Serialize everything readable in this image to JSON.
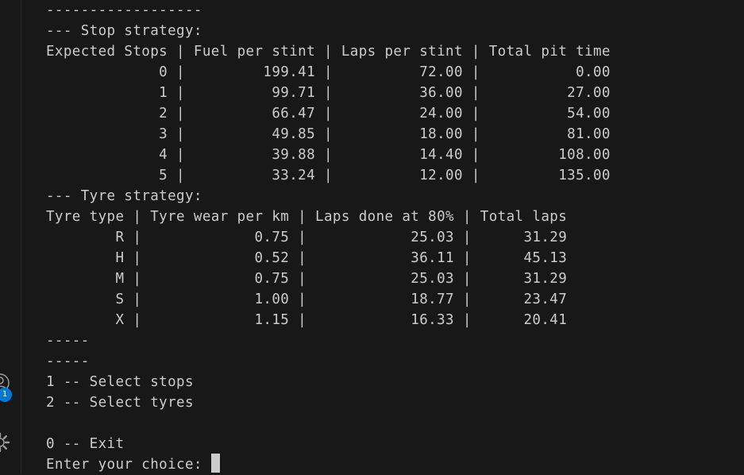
{
  "sidebar": {
    "account_icon": "account-icon",
    "notification_badge": "1",
    "settings_icon": "gear-icon",
    "accent_color": "#0078d4"
  },
  "terminal": {
    "lines": [
      "------------------",
      "--- Stop strategy:",
      "Expected Stops | Fuel per stint | Laps per stint | Total pit time",
      "             0 |         199.41 |          72.00 |           0.00",
      "             1 |          99.71 |          36.00 |          27.00",
      "             2 |          66.47 |          24.00 |          54.00",
      "             3 |          49.85 |          18.00 |          81.00",
      "             4 |          39.88 |          14.40 |         108.00",
      "             5 |          33.24 |          12.00 |         135.00",
      "--- Tyre strategy:",
      "Tyre type | Tyre wear per km | Laps done at 80% | Total laps",
      "        R |             0.75 |            25.03 |      31.29",
      "        H |             0.52 |            36.11 |      45.13",
      "        M |             0.75 |            25.03 |      31.29",
      "        S |             1.00 |            18.77 |      23.47",
      "        X |             1.15 |            16.33 |      20.41",
      "-----",
      "-----",
      "1 -- Select stops",
      "2 -- Select tyres",
      "",
      "0 -- Exit",
      "Enter your choice: "
    ]
  }
}
